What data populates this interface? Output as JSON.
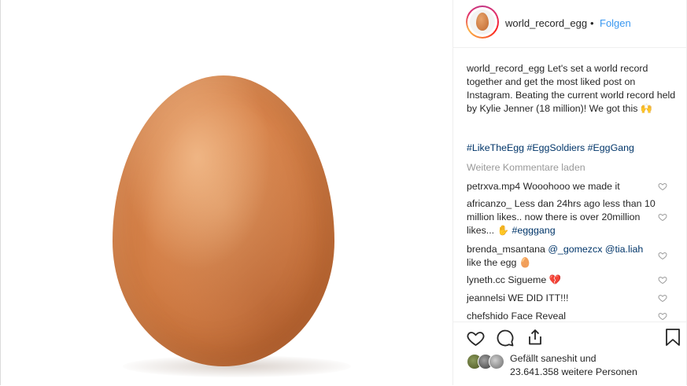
{
  "post": {
    "username": "world_record_egg",
    "separator": "•",
    "follow_label": "Folgen"
  },
  "caption": {
    "username": "world_record_egg",
    "text": "Let's set a world record together and get the most liked post on Instagram. Beating the current world record held by Kylie Jenner (18 million)! We got this 🙌"
  },
  "hashtags": [
    "#LikeTheEgg",
    "#EggSoldiers",
    "#EggGang"
  ],
  "load_more_label": "Weitere Kommentare laden",
  "comments": [
    {
      "user": "petrxva.mp4",
      "text": "Wooohooo we made it"
    },
    {
      "user": "africanzo_",
      "text": "Less dan 24hrs ago less than 10 million likes.. now there is over 20million likes... ✋",
      "tag": "#egggang"
    },
    {
      "user": "brenda_msantana",
      "mention1": "@_gomezcx",
      "mention2": "@tia.liah",
      "text": "like the egg 🥚"
    },
    {
      "user": "lyneth.cc",
      "text": "Sigueme 💔"
    },
    {
      "user": "jeannelsi",
      "text": "WE DID ITT!!!"
    },
    {
      "user": "chefshido",
      "text": "Face Reveal"
    }
  ],
  "likes": {
    "line1": "Gefällt saneshit und",
    "line2": "23.641.358 weitere Personen"
  },
  "colors": {
    "link_blue": "#3897f0",
    "hashtag_blue": "#003569",
    "muted_gray": "#999999",
    "text": "#262626"
  },
  "icons": [
    "heart-icon",
    "comment-icon",
    "share-icon",
    "bookmark-icon"
  ]
}
